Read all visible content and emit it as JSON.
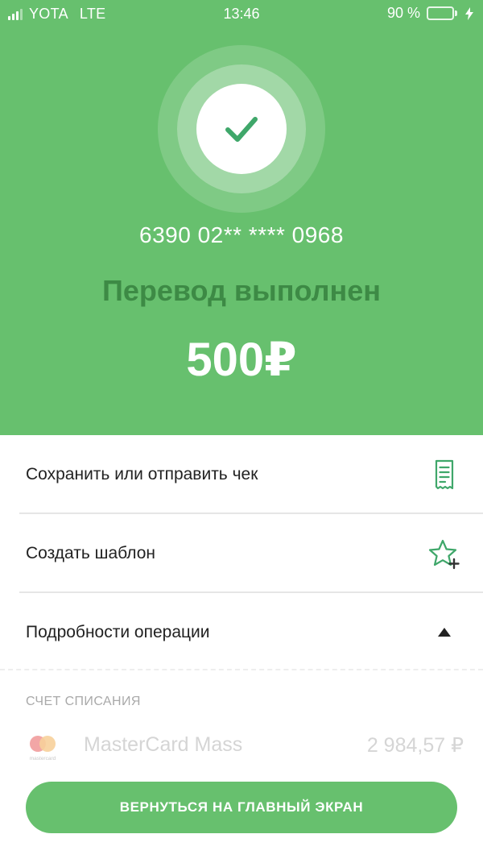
{
  "status_bar": {
    "carrier": "YOTA",
    "network": "LTE",
    "time": "13:46",
    "battery_percent": "90 %",
    "battery_level": 0.9
  },
  "result": {
    "icon": "checkmark-icon",
    "card_number": "6390 02** **** 0968",
    "status": "Перевод выполнен",
    "amount": "500₽"
  },
  "actions": [
    {
      "label": "Сохранить или отправить чек",
      "icon": "receipt-icon"
    },
    {
      "label": "Создать шаблон",
      "icon": "star-plus-icon"
    },
    {
      "label": "Подробности операции",
      "icon": "triangle-up-icon"
    }
  ],
  "details": {
    "debit_account_title": "СЧЕТ СПИСАНИЯ",
    "account_name": "MasterCard Mass",
    "account_balance": "2 984,57 ₽",
    "logo_text": "mastercard"
  },
  "home_button": {
    "label": "ВЕРНУТЬСЯ НА ГЛАВНЫЙ ЭКРАН"
  },
  "colors": {
    "accent": "#67c06e",
    "status_text_dark": "#3d8a45",
    "icon_stroke": "#3fa76a"
  }
}
